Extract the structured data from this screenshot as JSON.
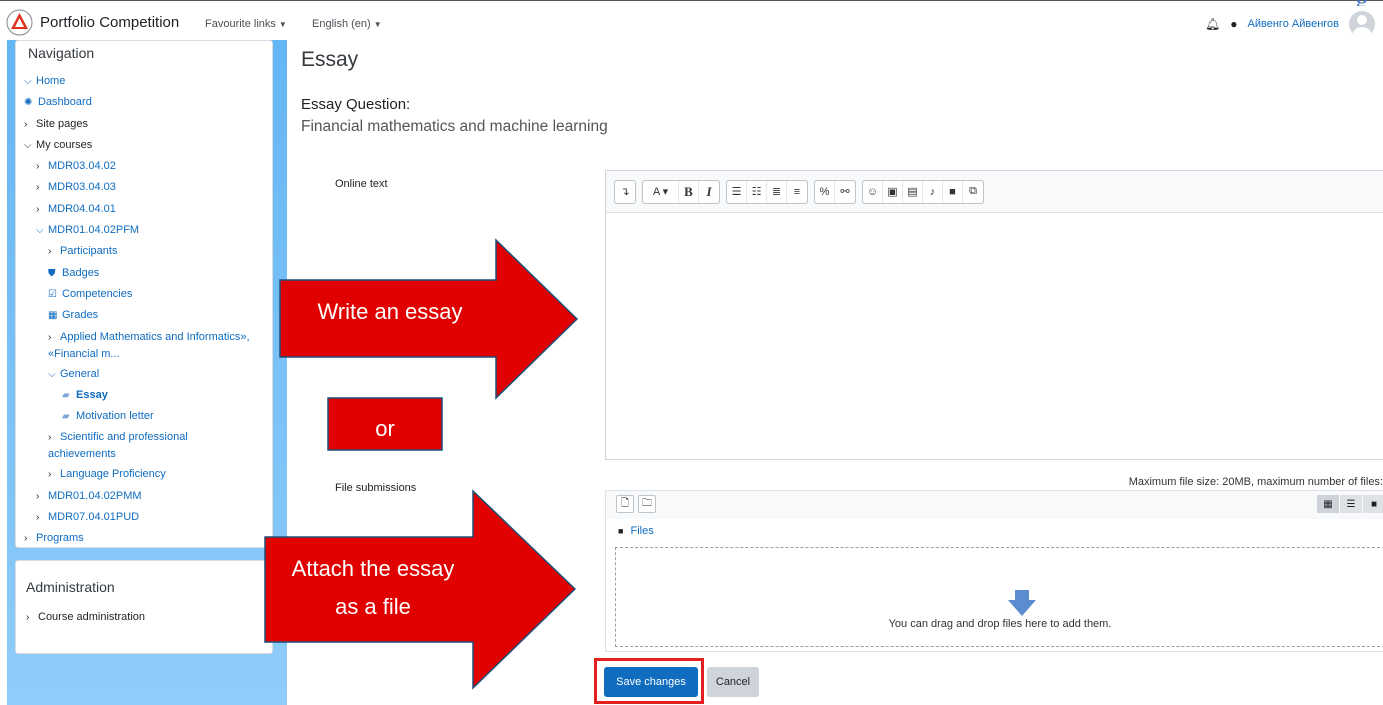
{
  "header": {
    "site_name": "Portfolio Competition",
    "favourites": "Favourite links",
    "language": "English (en)",
    "user": "Айвенго Айвенгов",
    "corner_glyph": "g"
  },
  "navigation": {
    "title": "Navigation",
    "home": "Home",
    "dashboard": "Dashboard",
    "site_pages": "Site pages",
    "my_courses": "My courses",
    "courses": [
      "MDR03.04.02",
      "MDR03.04.03",
      "MDR04.04.01",
      "MDR01.04.02PFM"
    ],
    "participants": "Participants",
    "badges": "Badges",
    "competencies": "Competencies",
    "grades": "Grades",
    "applied_math": "Applied Mathematics and Informatics», «Financial m...",
    "general": "General",
    "essay": "Essay",
    "motivation": "Motivation letter",
    "scientific": "Scientific and professional achievements",
    "language": "Language Proficiency",
    "more_courses": [
      "MDR01.04.02PMM",
      "MDR07.04.01PUD"
    ],
    "programs": "Programs"
  },
  "administration": {
    "title": "Administration",
    "course_admin": "Course administration"
  },
  "main": {
    "title": "Essay",
    "question_label": "Essay Question:",
    "question_text": "Financial mathematics and machine learning",
    "online_text_label": "Online text",
    "file_submissions_label": "File submissions",
    "max_size": "Maximum file size: 20MB, maximum number of files:",
    "files_link": "Files",
    "drop_text": "You can drag and drop files here to add them.",
    "save": "Save changes",
    "cancel": "Cancel"
  },
  "annotations": {
    "write": "Write an essay",
    "or": "or",
    "attach_line1": "Attach the essay",
    "attach_line2": "as a file"
  },
  "colors": {
    "accent": "#0f6cbf",
    "annotation_red": "#e00000",
    "drawer": "#64b6f5"
  }
}
